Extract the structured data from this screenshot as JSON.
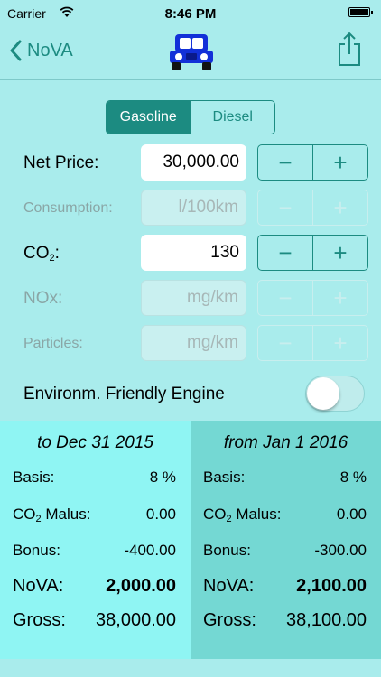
{
  "status": {
    "carrier": "Carrier",
    "time": "8:46 PM"
  },
  "nav": {
    "back_label": "NoVA"
  },
  "fuel": {
    "options": [
      "Gasoline",
      "Diesel"
    ],
    "selected": "Gasoline"
  },
  "inputs": {
    "net_price": {
      "label": "Net Price:",
      "value": "30,000.00"
    },
    "consumption": {
      "label": "Consumption:",
      "placeholder": "l/100km"
    },
    "co2": {
      "label_main": "CO",
      "label_sub": "2",
      "label_end": ":",
      "value": "130"
    },
    "nox": {
      "label": "NOx:",
      "placeholder": "mg/km"
    },
    "particles": {
      "label": "Particles:",
      "placeholder": "mg/km"
    }
  },
  "stepper": {
    "minus": "−",
    "plus": "+"
  },
  "engine": {
    "label": "Environm. Friendly Engine",
    "on": false
  },
  "results": {
    "left": {
      "title": "to Dec 31 2015",
      "basis_label": "Basis:",
      "basis": "8 %",
      "malus_label_main": "CO",
      "malus_label_sub": "2",
      "malus_label_end": " Malus:",
      "malus": "0.00",
      "bonus_label": "Bonus:",
      "bonus": "-400.00",
      "nova_label": "NoVA:",
      "nova": "2,000.00",
      "gross_label": "Gross:",
      "gross": "38,000.00"
    },
    "right": {
      "title": "from Jan 1 2016",
      "basis_label": "Basis:",
      "basis": "8 %",
      "malus_label_main": "CO",
      "malus_label_sub": "2",
      "malus_label_end": " Malus:",
      "malus": "0.00",
      "bonus_label": "Bonus:",
      "bonus": "-300.00",
      "nova_label": "NoVA:",
      "nova": "2,100.00",
      "gross_label": "Gross:",
      "gross": "38,100.00"
    }
  },
  "colors": {
    "accent": "#1c8b81",
    "background": "#a9ecec",
    "panel_left": "#8ff5f3",
    "panel_right": "#74d8d3",
    "car": "#1230d8"
  }
}
